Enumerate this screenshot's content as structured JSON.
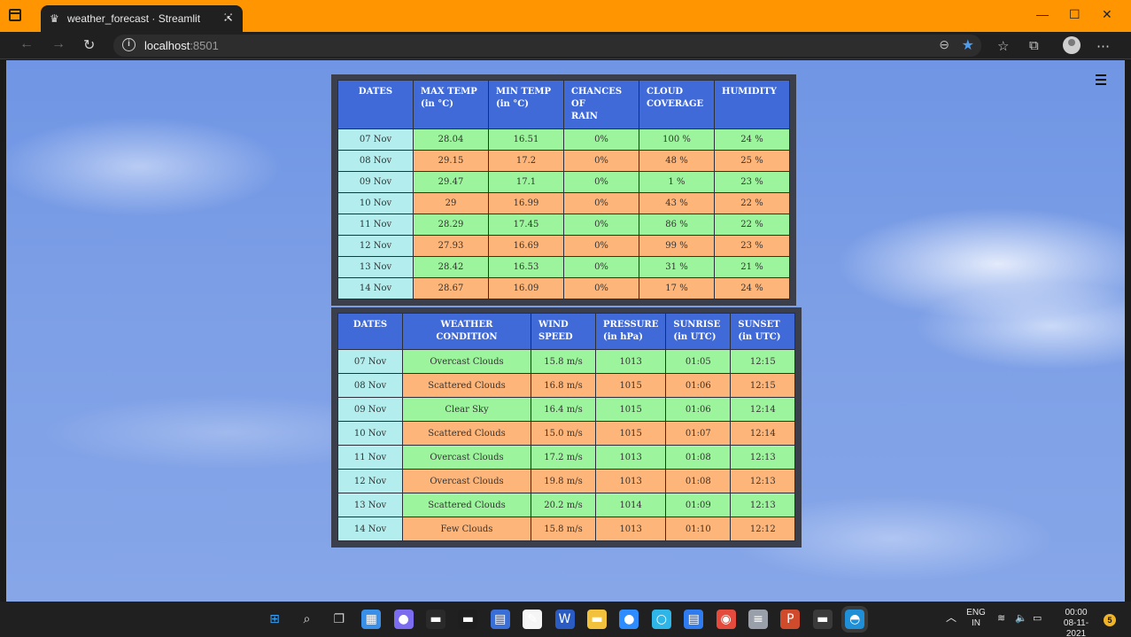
{
  "browser": {
    "tab_title": "weather_forecast · Streamlit",
    "url_host": "localhost",
    "url_port": ":8501",
    "accent": "#ff9500"
  },
  "table1": {
    "headers": [
      "DATES",
      "MAX TEMP (in °C)",
      "MIN TEMP (in °C)",
      "CHANCES OF RAIN",
      "CLOUD COVERAGE",
      "HUMIDITY"
    ],
    "header_lines": [
      [
        "DATES"
      ],
      [
        "MAX TEMP",
        "(in °C)"
      ],
      [
        "MIN TEMP",
        "(in °C)"
      ],
      [
        "CHANCES OF",
        "RAIN"
      ],
      [
        "CLOUD",
        "COVERAGE"
      ],
      [
        "HUMIDITY"
      ]
    ],
    "rows": [
      [
        "07 Nov",
        "28.04",
        "16.51",
        "0%",
        "100 %",
        "24 %"
      ],
      [
        "08 Nov",
        "29.15",
        "17.2",
        "0%",
        "48 %",
        "25 %"
      ],
      [
        "09 Nov",
        "29.47",
        "17.1",
        "0%",
        "1 %",
        "23 %"
      ],
      [
        "10 Nov",
        "29",
        "16.99",
        "0%",
        "43 %",
        "22 %"
      ],
      [
        "11 Nov",
        "28.29",
        "17.45",
        "0%",
        "86 %",
        "22 %"
      ],
      [
        "12 Nov",
        "27.93",
        "16.69",
        "0%",
        "99 %",
        "23 %"
      ],
      [
        "13 Nov",
        "28.42",
        "16.53",
        "0%",
        "31 %",
        "21 %"
      ],
      [
        "14 Nov",
        "28.67",
        "16.09",
        "0%",
        "17 %",
        "24 %"
      ]
    ]
  },
  "table2": {
    "headers": [
      "DATES",
      "WEATHER CONDITION",
      "WIND SPEED",
      "PRESSURE (in hPa)",
      "SUNRISE (in UTC)",
      "SUNSET (in UTC)"
    ],
    "header_lines": [
      [
        "DATES"
      ],
      [
        "WEATHER CONDITION"
      ],
      [
        "WIND",
        "SPEED"
      ],
      [
        "PRESSURE",
        "(in hPa)"
      ],
      [
        "SUNRISE",
        "(in UTC)"
      ],
      [
        "SUNSET",
        "(in UTC)"
      ]
    ],
    "rows": [
      [
        "07 Nov",
        "Overcast Clouds",
        "15.8 m/s",
        "1013",
        "01:05",
        "12:15"
      ],
      [
        "08 Nov",
        "Scattered Clouds",
        "16.8 m/s",
        "1015",
        "01:06",
        "12:15"
      ],
      [
        "09 Nov",
        "Clear Sky",
        "16.4 m/s",
        "1015",
        "01:06",
        "12:14"
      ],
      [
        "10 Nov",
        "Scattered Clouds",
        "15.0 m/s",
        "1015",
        "01:07",
        "12:14"
      ],
      [
        "11 Nov",
        "Overcast Clouds",
        "17.2 m/s",
        "1013",
        "01:08",
        "12:13"
      ],
      [
        "12 Nov",
        "Overcast Clouds",
        "19.8 m/s",
        "1013",
        "01:08",
        "12:13"
      ],
      [
        "13 Nov",
        "Scattered Clouds",
        "20.2 m/s",
        "1014",
        "01:09",
        "12:13"
      ],
      [
        "14 Nov",
        "Few Clouds",
        "15.8 m/s",
        "1013",
        "01:10",
        "12:12"
      ]
    ]
  },
  "colors": {
    "header_bg": "#3f6ad8",
    "date_bg": "#b3eded",
    "green_row": "#9cf59c",
    "orange_row": "#fdb57a"
  },
  "taskbar": {
    "icons": [
      "windows-start-icon",
      "search-icon",
      "task-view-icon",
      "widgets-icon",
      "teams-chat-icon",
      "terminal-icon",
      "mysql-workbench-icon",
      "dev-cpp-icon",
      "notepad-icon",
      "word-icon",
      "file-explorer-icon",
      "zoom-icon",
      "alexa-icon",
      "notes-icon",
      "chrome-icon",
      "database-icon",
      "powerpoint-icon",
      "command-prompt-icon",
      "edge-icon"
    ],
    "lang_top": "ENG",
    "lang_bottom": "IN",
    "time": "00:00",
    "date": "08-11-2021",
    "notifications": "5"
  }
}
